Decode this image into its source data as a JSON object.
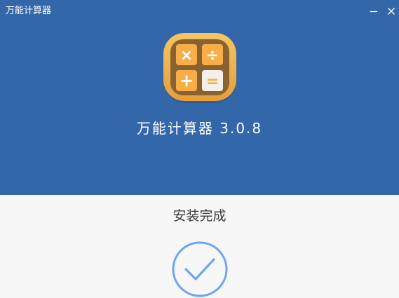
{
  "window": {
    "title": "万能计算器",
    "minimize_icon": "minimize-icon",
    "close_icon": "close-icon"
  },
  "app": {
    "logo_icon": "calculator-app-icon",
    "name": "万能计算器 3.0.8",
    "logo_symbols": [
      "×",
      "÷",
      "+",
      "="
    ]
  },
  "install": {
    "status": "安装完成",
    "status_icon": "checkmark-circle-icon"
  },
  "colors": {
    "header_bg": "#3467aa",
    "content_bg": "#f7f7f7",
    "accent": "#6aa6f3",
    "logo_frame": "#f0b550",
    "logo_inner": "#8a6232",
    "logo_key": "#f7ad48"
  }
}
